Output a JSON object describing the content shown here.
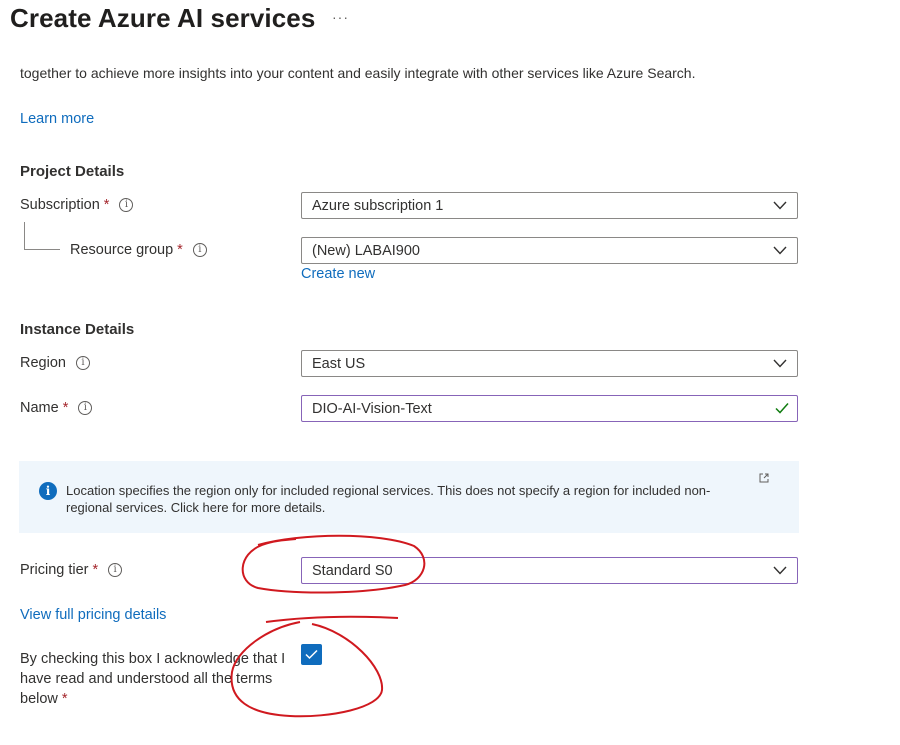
{
  "header": {
    "title": "Create Azure AI services",
    "more_label": "···"
  },
  "intro": {
    "description": "together to achieve more insights into your content and easily integrate with other services like Azure Search.",
    "learn_more": "Learn more"
  },
  "project_details": {
    "title": "Project Details",
    "subscription": {
      "label": "Subscription",
      "required": "*",
      "value": "Azure subscription 1"
    },
    "resource_group": {
      "label": "Resource group",
      "required": "*",
      "value": "(New) LABAI900",
      "create_new": "Create new"
    }
  },
  "instance_details": {
    "title": "Instance Details",
    "region": {
      "label": "Region",
      "value": "East US"
    },
    "name": {
      "label": "Name",
      "required": "*",
      "value": "DIO-AI-Vision-Text"
    }
  },
  "info_box": {
    "text": "Location specifies the region only for included regional services. This does not specify a region for included non-regional services. Click here for more details."
  },
  "pricing": {
    "label": "Pricing tier",
    "required": "*",
    "value": "Standard S0",
    "details_link": "View full pricing details"
  },
  "acknowledge": {
    "text": "By checking this box I acknowledge that I have read and understood all the terms below",
    "required": "*",
    "checked": true
  },
  "icons": {
    "info": "info-circle-icon",
    "chevron": "chevron-down-icon",
    "valid": "checkmark-icon",
    "external": "external-link-icon"
  },
  "colors": {
    "link": "#0f6cbd",
    "required": "#a4262c",
    "annotation": "#d0191f",
    "valid": "#107c10",
    "focus_border": "#8764b8"
  }
}
